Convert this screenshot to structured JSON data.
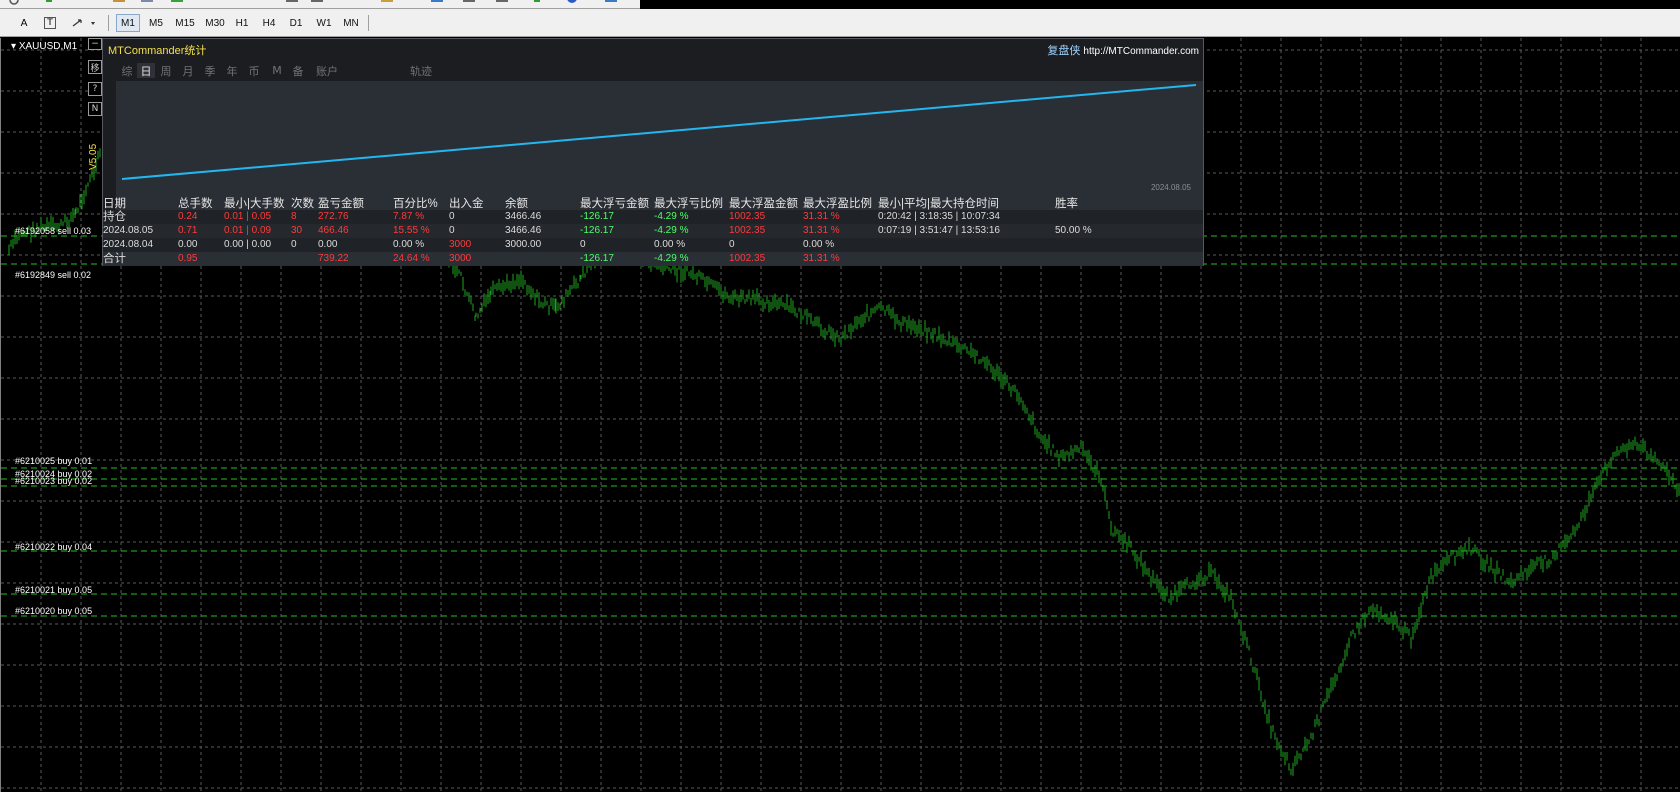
{
  "toolbar": {
    "draw_tools": [
      {
        "icon": "text-A-icon",
        "label": "A"
      },
      {
        "icon": "text-label-icon",
        "label": "T"
      },
      {
        "icon": "arrows-icon",
        "label": "⬌"
      }
    ],
    "timeframes": [
      "M1",
      "M5",
      "M15",
      "M30",
      "H1",
      "H4",
      "D1",
      "W1",
      "MN"
    ],
    "active_timeframe": "M1"
  },
  "chart": {
    "symbol": "XAUUSD,M1",
    "version": "V5.05",
    "orders": [
      {
        "label": "#6192058 sell 0.03"
      },
      {
        "label": "#6192849 sell 0.02"
      },
      {
        "label": "#6210025 buy 0.01"
      },
      {
        "label": "#6210024 buy 0.02"
      },
      {
        "label": "#6210023 buy 0.02"
      },
      {
        "label": "#6210022 buy 0.04"
      },
      {
        "label": "#6210021 buy 0.05"
      },
      {
        "label": "#6210020 buy 0.05"
      }
    ],
    "colors": {
      "candle": "#1fa31f",
      "grid": "#5a5a5a",
      "sell_line": "#1fbf1f",
      "buy_line": "#1fbf1f"
    }
  },
  "panel": {
    "title": "MTCommander统计",
    "replay_label": "复盘侠",
    "url": "http://MTCommander.com",
    "side_buttons": [
      "移",
      "?",
      "N"
    ],
    "tabs": [
      "综",
      "日",
      "周",
      "月",
      "季",
      "年",
      "币",
      "M",
      "备",
      "账户",
      "轨迹"
    ],
    "active_tab": "日",
    "equity_date": "2024.08.05",
    "equity_color": "#23b7f0",
    "columns": [
      "日期",
      "总手数",
      "最小|大手数",
      "次数",
      "盈亏金额",
      "百分比%",
      "出入金",
      "余额",
      "最大浮亏金额",
      "最大浮亏比例",
      "最大浮盈金额",
      "最大浮盈比例",
      "最小|平均|最大持仓时间",
      "胜率"
    ],
    "rows": [
      {
        "date": "持仓",
        "lots": "0.24",
        "minmax": "0.01 | 0.05",
        "count": "8",
        "pnl": "272.76",
        "pct": "7.87 %",
        "inout": "0",
        "balance": "3466.46",
        "max_loss": "-126.17",
        "max_loss_pct": "-4.29 %",
        "max_profit": "1002.35",
        "max_profit_pct": "31.31 %",
        "hold": "0:20:42 | 3:18:35 | 10:07:34",
        "winrate": ""
      },
      {
        "date": "2024.08.05",
        "lots": "0.71",
        "minmax": "0.01 | 0.09",
        "count": "30",
        "pnl": "466.46",
        "pct": "15.55 %",
        "inout": "0",
        "balance": "3466.46",
        "max_loss": "-126.17",
        "max_loss_pct": "-4.29 %",
        "max_profit": "1002.35",
        "max_profit_pct": "31.31 %",
        "hold": "0:07:19 | 3:51:47 | 13:53:16",
        "winrate": "50.00 %"
      },
      {
        "date": "2024.08.04",
        "lots": "0.00",
        "minmax": "0.00 | 0.00",
        "count": "0",
        "pnl": "0.00",
        "pct": "0.00 %",
        "inout": "3000",
        "balance": "3000.00",
        "max_loss": "0",
        "max_loss_pct": "0.00 %",
        "max_profit": "0",
        "max_profit_pct": "0.00 %",
        "hold": "",
        "winrate": ""
      },
      {
        "date": "合计",
        "lots": "0.95",
        "minmax": "",
        "count": "",
        "pnl": "739.22",
        "pct": "24.64 %",
        "inout": "3000",
        "balance": "",
        "max_loss": "-126.17",
        "max_loss_pct": "-4.29 %",
        "max_profit": "1002.35",
        "max_profit_pct": "31.31 %",
        "hold": "",
        "winrate": ""
      }
    ]
  }
}
